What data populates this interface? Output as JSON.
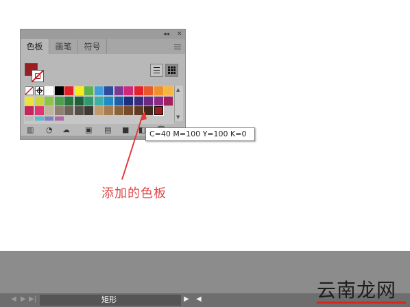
{
  "panel": {
    "title_controls": [
      "◂◂",
      "✕"
    ],
    "tabs": [
      {
        "label": "色板",
        "active": true
      },
      {
        "label": "画笔",
        "active": false
      },
      {
        "label": "符号",
        "active": false
      }
    ],
    "fill_color": "#9a1d22",
    "swatch_rows": [
      [
        "none",
        "registration",
        "#ffffff",
        "#000000",
        "#e21e26",
        "#f7ec1b",
        "#5fb24a",
        "#3fa0d7",
        "#2c4c9c",
        "#7a3a93",
        "#cf2a7a",
        "#e5222a",
        "#e8592a",
        "#f0902b",
        "#f7b63f"
      ],
      [
        "#eae33b",
        "#c8d73b",
        "#8cc34a",
        "#4ba04a",
        "#26793d",
        "#1f5f3a",
        "#2e9a6f",
        "#3bb0a6",
        "#1f8dc5",
        "#1c5faa",
        "#1f2f7e",
        "#3c2a7e",
        "#6a2a86",
        "#8e2a83",
        "#a31f5d"
      ],
      [
        "#c6245a",
        "#e0336f",
        "#c2b49a",
        "#8f8171",
        "#6e6256",
        "#545049",
        "#3d3a36",
        "#c19a6b",
        "#a57b4f",
        "#8c6239",
        "#754b2b",
        "#5e3b22",
        "#42281a",
        "#9a1d22"
      ]
    ],
    "partial_row": [
      "#b9b9b9",
      "#5bbdd0",
      "#7f7fc4",
      "#b06aa8"
    ],
    "toolbar_icons": [
      "swatch-libraries-icon",
      "color-group-edit-icon",
      "cloud-library-icon",
      "swatch-options-icon",
      "new-color-group-icon",
      "new-swatch-icon",
      "delete-swatch-icon"
    ]
  },
  "tooltip": {
    "text": "C=40 M=100 Y=100 K=0"
  },
  "annotation": {
    "label": "添加的色板",
    "color": "#e04a4a"
  },
  "statusbar": {
    "nav_glyphs": [
      "◀",
      "▶",
      "▶|"
    ],
    "label": "矩形",
    "play": "▶",
    "scroll_left": "◀"
  },
  "watermark": {
    "text": "云南龙网"
  }
}
